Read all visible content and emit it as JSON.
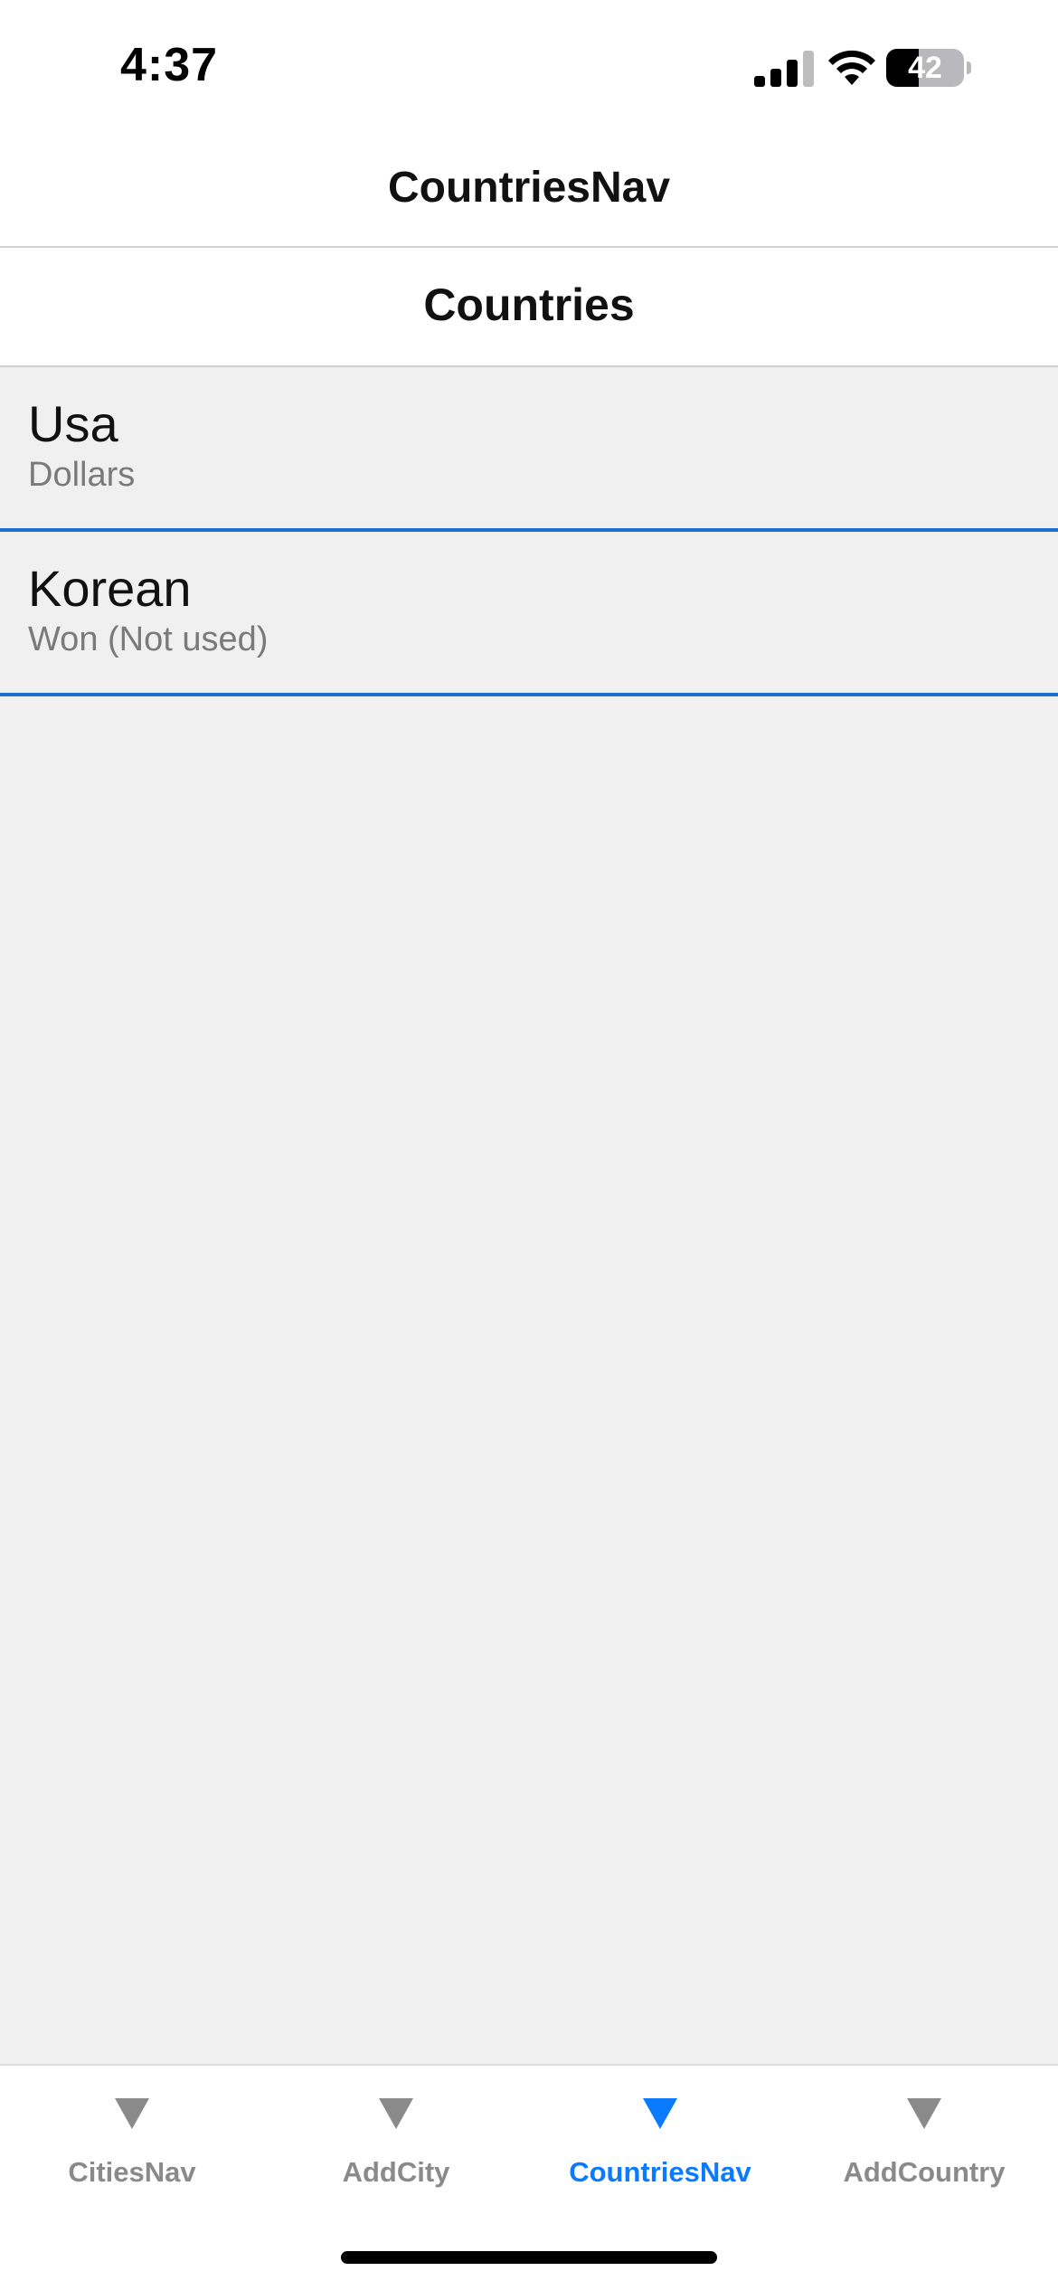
{
  "status_bar": {
    "time": "4:37",
    "battery_level": "42",
    "icons": [
      "signal-icon",
      "wifi-icon",
      "battery-icon"
    ]
  },
  "nav": {
    "title": "CountriesNav"
  },
  "page": {
    "title": "Countries"
  },
  "countries": [
    {
      "name": "Usa",
      "currency": "Dollars"
    },
    {
      "name": "Korean",
      "currency": "Won (Not used)"
    }
  ],
  "tabs": [
    {
      "label": "CitiesNav",
      "icon": "triangle-down-icon",
      "active": false
    },
    {
      "label": "AddCity",
      "icon": "triangle-down-icon",
      "active": false
    },
    {
      "label": "CountriesNav",
      "icon": "triangle-down-icon",
      "active": true
    },
    {
      "label": "AddCountry",
      "icon": "triangle-down-icon",
      "active": false
    }
  ],
  "colors": {
    "accent": "#0a7aff",
    "separator": "#1f6fd1",
    "background": "#f0f0f0",
    "inactive_tab": "#8a8a8a"
  }
}
